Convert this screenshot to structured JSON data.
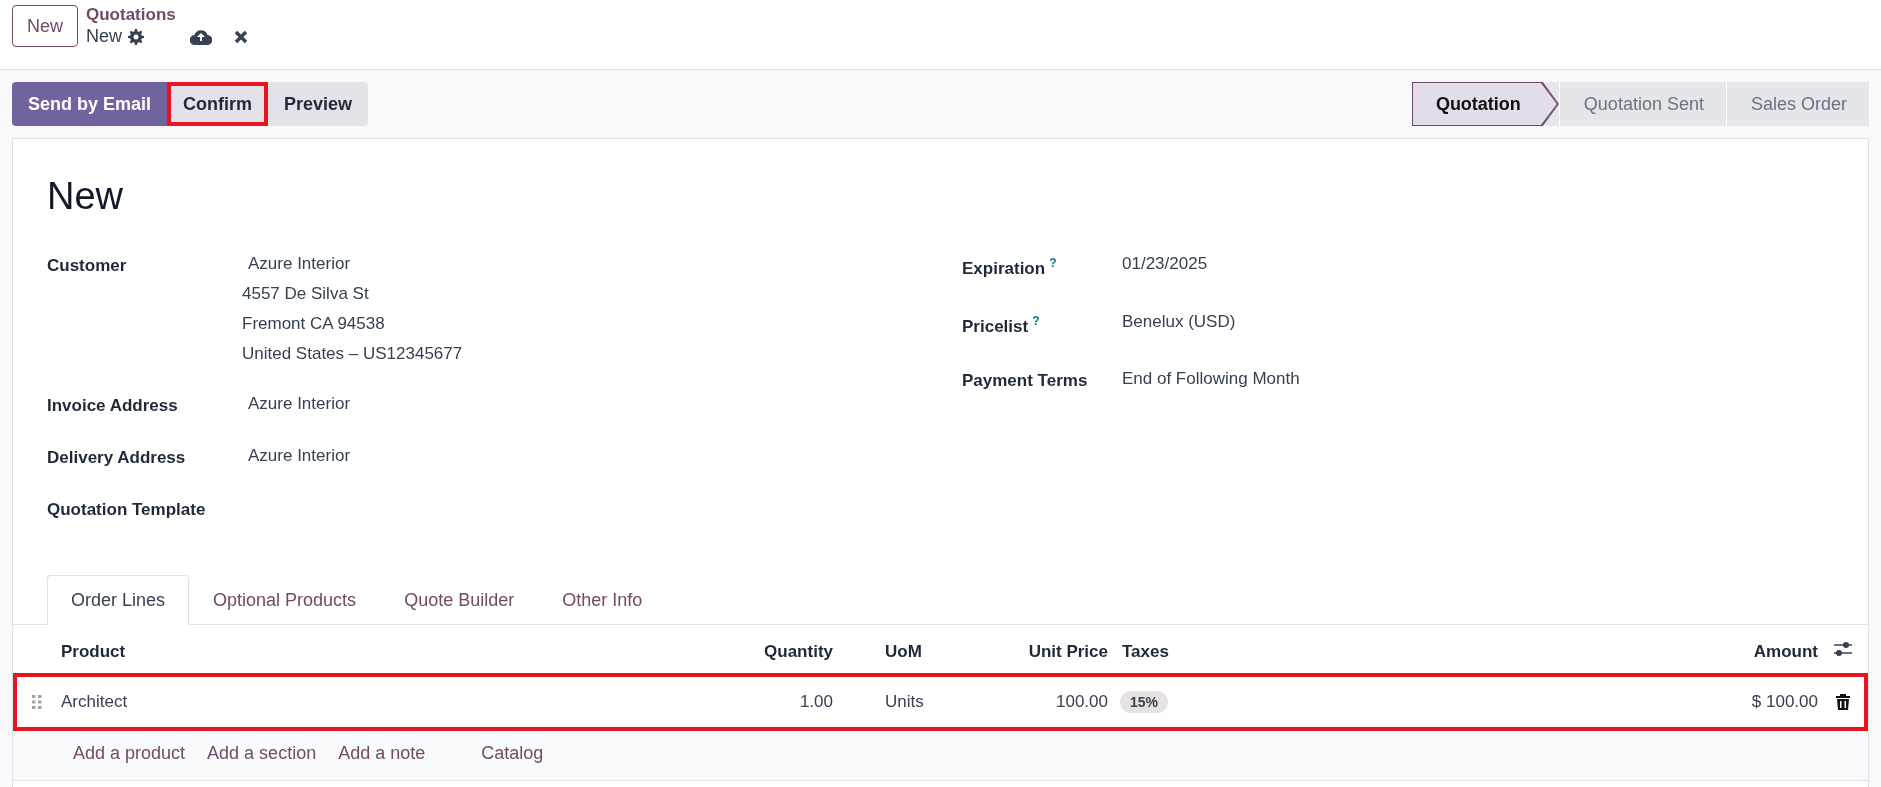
{
  "top_bar": {
    "new_button": "New",
    "breadcrumb": "Quotations",
    "record": "New"
  },
  "actions": [
    {
      "label": "Send by Email",
      "kind": "primary",
      "highlighted": false
    },
    {
      "label": "Confirm",
      "kind": "secondary",
      "highlighted": true
    },
    {
      "label": "Preview",
      "kind": "secondary",
      "highlighted": false
    }
  ],
  "status_bar": [
    {
      "label": "Quotation",
      "selected": true
    },
    {
      "label": "Quotation Sent",
      "selected": false
    },
    {
      "label": "Sales Order",
      "selected": false
    }
  ],
  "title": "New",
  "left_fields": [
    {
      "label": "Customer",
      "lines": [
        "Azure Interior",
        "4557 De Silva St",
        "Fremont CA 94538",
        "United States – US12345677"
      ]
    },
    {
      "label": "Invoice Address",
      "lines": [
        "Azure Interior"
      ]
    },
    {
      "label": "Delivery Address",
      "lines": [
        "Azure Interior"
      ]
    },
    {
      "label": "Quotation Template"
    }
  ],
  "right_fields": [
    {
      "label": "Expiration",
      "help": "?",
      "value": "01/23/2025"
    },
    {
      "label": "Pricelist",
      "help": "?",
      "value": "Benelux (USD)"
    },
    {
      "label": "Payment Terms",
      "value": "End of Following Month"
    }
  ],
  "tabs": [
    {
      "label": "Order Lines",
      "selected": true
    },
    {
      "label": "Optional Products",
      "selected": false
    },
    {
      "label": "Quote Builder",
      "selected": false
    },
    {
      "label": "Other Info",
      "selected": false
    }
  ],
  "table": {
    "columns": [
      "Product",
      "Quantity",
      "UoM",
      "Unit Price",
      "Taxes",
      "Amount"
    ],
    "rows": [
      {
        "product": "Architect",
        "quantity": "1.00",
        "uom": "Units",
        "unit_price": "100.00",
        "taxes": "15%",
        "amount": "$ 100.00",
        "highlighted": true
      }
    ],
    "add_links": [
      "Add a product",
      "Add a section",
      "Add a note",
      "Catalog"
    ]
  }
}
